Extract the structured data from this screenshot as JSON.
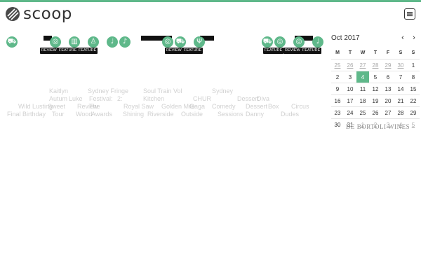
{
  "brand": {
    "name": "scoop",
    "accent": "#5fb88a"
  },
  "nav": {
    "menu_icon": "hamburger-icon"
  },
  "feed_icons": [
    {
      "name": "suitcase-icon",
      "glyph": "⛟"
    },
    {
      "name": "disc-icon",
      "glyph": "◎"
    },
    {
      "name": "book-icon",
      "glyph": "▥"
    },
    {
      "name": "person-icon",
      "glyph": "♙"
    },
    {
      "name": "guitar-icon",
      "glyph": "♩"
    },
    {
      "name": "dance-icon",
      "glyph": "♪"
    },
    {
      "name": "disc-icon",
      "glyph": "◎"
    },
    {
      "name": "suitcase-icon",
      "glyph": "⛟"
    },
    {
      "name": "fork-icon",
      "glyph": "Ψ"
    },
    {
      "name": "suitcase-icon",
      "glyph": "⛟"
    },
    {
      "name": "compass-icon",
      "glyph": "◎"
    },
    {
      "name": "disc-icon",
      "glyph": "◎"
    },
    {
      "name": "guitar-icon",
      "glyph": "♩"
    }
  ],
  "badges": [
    "REVIEW",
    "FEATURE",
    "FEATURE",
    "REVIEW",
    "FEATURE",
    "FEATURE",
    "REVIEW",
    "FEATURE"
  ],
  "ghost_text": [
    "Kaitlyn",
    "Sydney Fringe",
    "Soul Train Vol",
    "Sydney",
    "Autum",
    "Luke",
    "Festival:",
    "2:",
    "Kitchen",
    "CHUR",
    "Dessert",
    "Diva",
    "Wild Lusting",
    "Sweet",
    "Review",
    "The",
    "Royal Saw",
    "Golden Mile",
    "Gaga",
    "Comedy",
    "Dessert",
    "Box",
    "Circus",
    "Final Birthday",
    "Tour",
    "Wood",
    "Awards",
    "Shining",
    "Riverside",
    "Outside",
    "Sessions",
    "Danny",
    "Dudes"
  ],
  "calendar": {
    "title": "Oct 2017",
    "prev_icon": "‹",
    "next_icon": "›",
    "weekdays": [
      "M",
      "T",
      "W",
      "T",
      "F",
      "S",
      "S"
    ],
    "weeks": [
      [
        "25",
        "26",
        "27",
        "28",
        "29",
        "30",
        "1"
      ],
      [
        "2",
        "3",
        "4",
        "5",
        "6",
        "7",
        "8"
      ],
      [
        "9",
        "10",
        "11",
        "12",
        "13",
        "14",
        "15"
      ],
      [
        "16",
        "17",
        "18",
        "19",
        "20",
        "21",
        "22"
      ],
      [
        "23",
        "24",
        "25",
        "26",
        "27",
        "28",
        "29"
      ],
      [
        "30",
        "31",
        "1",
        "2",
        "3",
        "4",
        "5"
      ]
    ],
    "today": "4"
  },
  "sponsor": {
    "text": "DE BORTOLI WINES"
  }
}
